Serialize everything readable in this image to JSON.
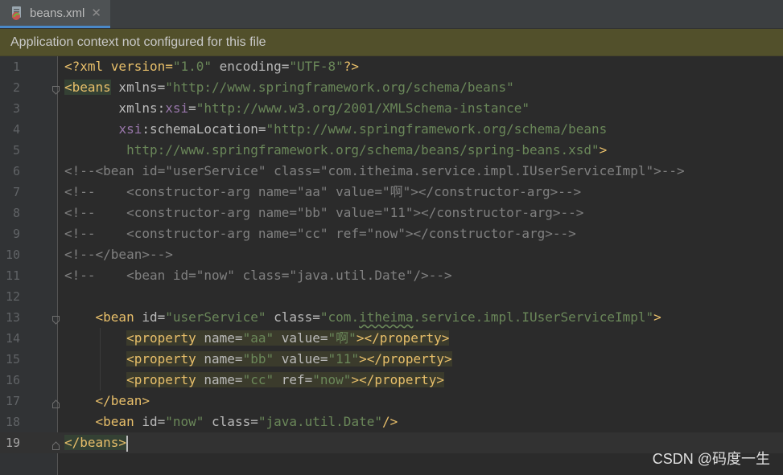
{
  "tab": {
    "filename": "beans.xml",
    "close_glyph": "✕",
    "icon": "xml-spring-file-icon"
  },
  "banner": {
    "message": "Application context not configured for this file"
  },
  "editor": {
    "current_line": 19,
    "lines": [
      {
        "n": "1"
      },
      {
        "n": "2"
      },
      {
        "n": "3"
      },
      {
        "n": "4"
      },
      {
        "n": "5"
      },
      {
        "n": "6"
      },
      {
        "n": "7"
      },
      {
        "n": "8"
      },
      {
        "n": "9"
      },
      {
        "n": "10"
      },
      {
        "n": "11"
      },
      {
        "n": "12"
      },
      {
        "n": "13"
      },
      {
        "n": "14"
      },
      {
        "n": "15"
      },
      {
        "n": "16"
      },
      {
        "n": "17"
      },
      {
        "n": "18"
      },
      {
        "n": "19"
      }
    ],
    "code": {
      "l1": {
        "a": "<?xml version=",
        "b": "\"1.0\"",
        "c": " encoding=",
        "d": "\"UTF-8\"",
        "e": "?>"
      },
      "l2": {
        "a": "<beans",
        "b": " xmlns=",
        "c": "\"http://www.springframework.org/schema/beans\""
      },
      "l3": {
        "a": "       xmlns:",
        "b": "xsi",
        "c": "=",
        "d": "\"http://www.w3.org/2001/XMLSchema-instance\""
      },
      "l4": {
        "a": "       ",
        "b": "xsi",
        "c": ":schemaLocation=",
        "d": "\"http://www.springframework.org/schema/beans"
      },
      "l5": {
        "a": "        ",
        "b": "http://www.springframework.org/schema/beans/spring-beans.xsd\"",
        "c": ">"
      },
      "l6": "<!--<bean id=\"userService\" class=\"com.itheima.service.impl.IUserServiceImpl\">-->",
      "l7": "<!--    <constructor-arg name=\"aa\" value=\"啊\"></constructor-arg>-->",
      "l8": "<!--    <constructor-arg name=\"bb\" value=\"11\"></constructor-arg>-->",
      "l9": "<!--    <constructor-arg name=\"cc\" ref=\"now\"></constructor-arg>-->",
      "l10": "<!--</bean>-->",
      "l11": "<!--    <bean id=\"now\" class=\"java.util.Date\"/>-->",
      "l13": {
        "indent": "    ",
        "a": "<bean",
        "b": " id=",
        "c": "\"userService\"",
        "d": " class=",
        "e1": "\"com.",
        "e2": "itheima",
        "e3": ".service.impl.IUserServiceImpl\"",
        "f": ">"
      },
      "l14": {
        "indent": "        ",
        "a": "<property",
        "b": " name=",
        "c": "\"aa\"",
        "d": " value=",
        "e": "\"啊\"",
        "f": "></property>"
      },
      "l15": {
        "indent": "        ",
        "a": "<property",
        "b": " name=",
        "c": "\"bb\"",
        "d": " value=",
        "e": "\"11\"",
        "f": "></property>"
      },
      "l16": {
        "indent": "        ",
        "a": "<property",
        "b": " name=",
        "c": "\"cc\"",
        "d": " ref=",
        "e": "\"now\"",
        "f": "></property>"
      },
      "l17": {
        "indent": "    ",
        "a": "</bean>"
      },
      "l18": {
        "indent": "    ",
        "a": "<bean",
        "b": " id=",
        "c": "\"now\"",
        "d": " class=",
        "e": "\"java.util.Date\"",
        "f": "/>"
      },
      "l19": {
        "a": "</beans>"
      }
    }
  },
  "watermark": "CSDN @码度一生"
}
